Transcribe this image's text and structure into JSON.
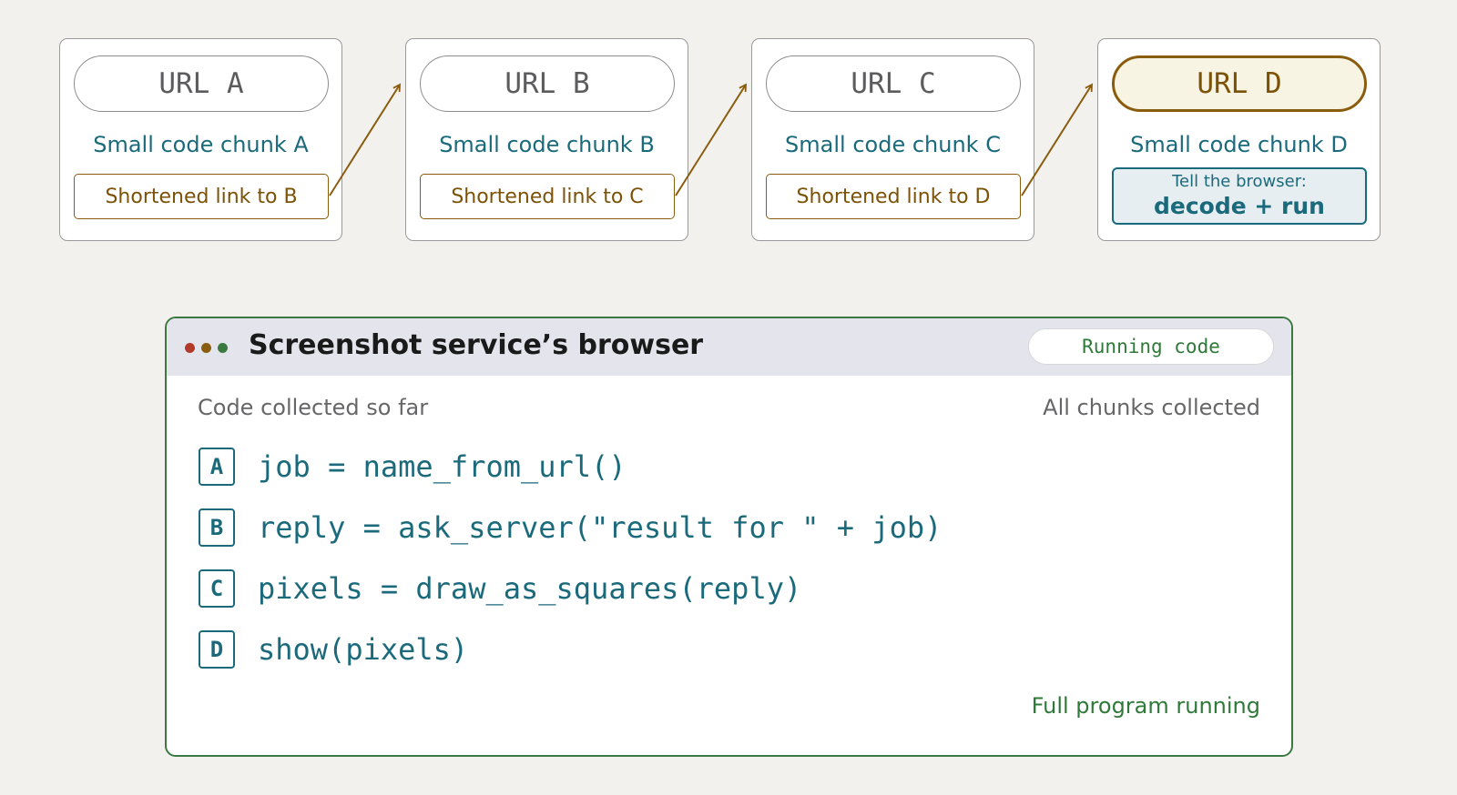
{
  "chain": {
    "cards": [
      {
        "url": "URL A",
        "chunk": "Small code chunk A",
        "link": "Shortened link to B"
      },
      {
        "url": "URL B",
        "chunk": "Small code chunk B",
        "link": "Shortened link to C"
      },
      {
        "url": "URL C",
        "chunk": "Small code chunk C",
        "link": "Shortened link to D"
      },
      {
        "url": "URL D",
        "chunk": "Small code chunk D",
        "instruction": "Tell the browser:",
        "action": "decode + run"
      }
    ]
  },
  "browser": {
    "title": "Screenshot service’s browser",
    "status_badge": "Running code",
    "collected_label": "Code collected so far",
    "collected_status": "All chunks collected",
    "code_lines": [
      {
        "badge": "A",
        "code": "job = name_from_url()"
      },
      {
        "badge": "B",
        "code": "reply = ask_server(\"result for \" + job)"
      },
      {
        "badge": "C",
        "code": "pixels = draw_as_squares(reply)"
      },
      {
        "badge": "D",
        "code": "show(pixels)"
      }
    ],
    "running_note": "Full program running"
  },
  "colors": {
    "background": "#f2f1ee",
    "link_accent": "#8a5c0e",
    "code_accent": "#1b6a7c",
    "running_accent": "#3a7a40",
    "dot_red": "#b23a2c"
  }
}
